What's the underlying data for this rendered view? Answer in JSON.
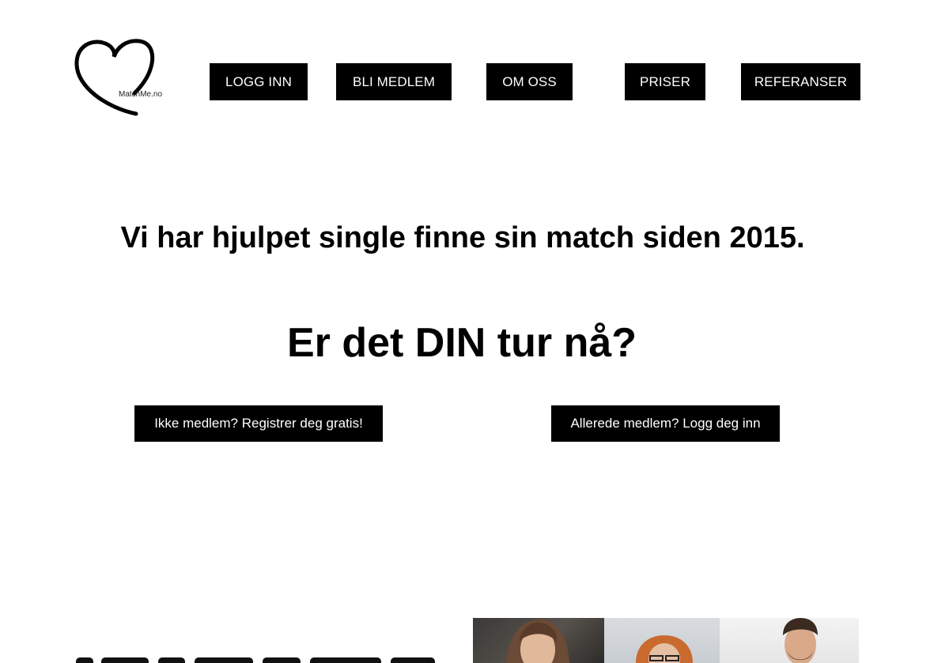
{
  "logo": {
    "text": "MatchMe.no",
    "icon": "heart-outline-icon"
  },
  "nav": {
    "items": [
      {
        "label": "LOGG INN"
      },
      {
        "label": "BLI MEDLEM"
      },
      {
        "label": "OM OSS"
      },
      {
        "label": "PRISER"
      },
      {
        "label": "REFERANSER"
      }
    ]
  },
  "hero": {
    "tagline": "Vi har hjulpet single finne sin match siden 2015.",
    "headline": "Er det DIN tur nå?",
    "register_button": "Ikke medlem? Registrer deg gratis!",
    "login_button": "Allerede medlem? Logg deg inn"
  },
  "colors": {
    "background": "#ffffff",
    "button_bg": "#000000",
    "button_text": "#ffffff",
    "text": "#000000"
  }
}
